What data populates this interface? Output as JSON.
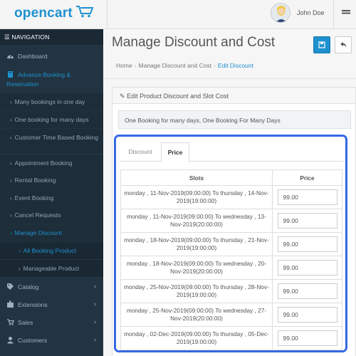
{
  "header": {
    "logo": "opencart",
    "username": "John Doe"
  },
  "sidebar": {
    "heading": "NAVIGATION",
    "dashboard": "Dashboard",
    "advance": "Advance Booking & Reservation",
    "sub": [
      "Many bookings in one day",
      "One booking for many days",
      "Customer Time Based Booking",
      "Appointment Booking",
      "Rental Booking",
      "Event Booking",
      "Cancel Requests",
      "Manage Discount"
    ],
    "sub2": [
      "All Booking Product",
      "Manageable Product"
    ],
    "bottom": [
      "Catalog",
      "Extensions",
      "Sales",
      "Customers"
    ]
  },
  "main": {
    "title": "Manage Discount and Cost",
    "breadcrumb": [
      "Home",
      "Manage Discount and Cost",
      "Edit Discount"
    ],
    "panel_title": "Edit Product Discount and Slot Cost",
    "info": "One Booking for many days, One Booking For Many Days",
    "tabs": [
      "Discount",
      "Price"
    ],
    "table": {
      "headers": [
        "Slots",
        "Price"
      ],
      "rows": [
        {
          "slot": "monday , 11-Nov-2019(09:00:00) To thursday , 14-Nov-2019(19:00:00)",
          "price": "99.00"
        },
        {
          "slot": "monday , 11-Nov-2019(09:00:00) To wednesday , 13-Nov-2019(20:00:00)",
          "price": "99.00"
        },
        {
          "slot": "monday , 18-Nov-2019(09:00:00) To thursday , 21-Nov-2019(19:00:00)",
          "price": "99.00"
        },
        {
          "slot": "monday , 18-Nov-2019(09:00:00) To wednesday , 20-Nov-2019(20:00:00)",
          "price": "99.00"
        },
        {
          "slot": "monday , 25-Nov-2019(09:00:00) To thursday , 28-Nov-2019(19:00:00)",
          "price": "99.00"
        },
        {
          "slot": "monday , 25-Nov-2019(09:00:00) To wednesday , 27-Nov-2019(20:00:00)",
          "price": "99.00"
        },
        {
          "slot": "monday , 02-Dec-2019(09:00:00) To thursday , 05-Dec-2019(19:00:00)",
          "price": "99.00"
        }
      ]
    }
  },
  "colors": {
    "accent": "#1e91cf",
    "sidebar": "#223441",
    "focus_border": "#3569e4"
  }
}
